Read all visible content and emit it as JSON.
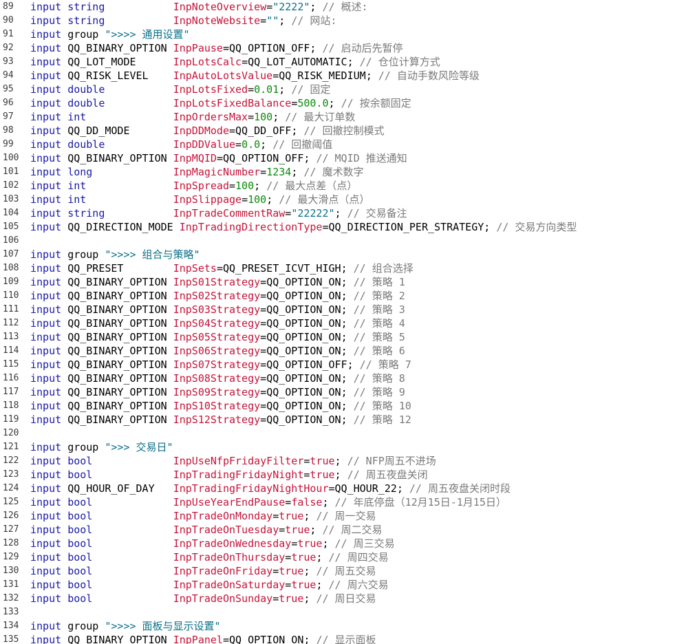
{
  "editor": {
    "lines": [
      {
        "no": "89",
        "kind": "decl",
        "kw": "input",
        "type": "string",
        "name": "InpNoteOverview",
        "value": "\"2222\"",
        "vtype": "str",
        "comment": "// 概述:"
      },
      {
        "no": "90",
        "kind": "decl",
        "kw": "input",
        "type": "string",
        "name": "InpNoteWebsite",
        "value": "\"\"",
        "vtype": "str",
        "comment": "// 网站:"
      },
      {
        "no": "91",
        "kind": "group",
        "kw": "input",
        "type": "group",
        "text": "\">>>> 通用设置\""
      },
      {
        "no": "92",
        "kind": "decl",
        "kw": "input",
        "type": "QQ_BINARY_OPTION",
        "name": "InpPause",
        "value": "QQ_OPTION_OFF",
        "vtype": "enum",
        "comment": "// 启动后先暂停"
      },
      {
        "no": "93",
        "kind": "decl",
        "kw": "input",
        "type": "QQ_LOT_MODE",
        "name": "InpLotsCalc",
        "value": "QQ_LOT_AUTOMATIC",
        "vtype": "enum",
        "comment": "// 仓位计算方式"
      },
      {
        "no": "94",
        "kind": "decl",
        "kw": "input",
        "type": "QQ_RISK_LEVEL",
        "name": "InpAutoLotsValue",
        "value": "QQ_RISK_MEDIUM",
        "vtype": "enum",
        "comment": "// 自动手数风险等级"
      },
      {
        "no": "95",
        "kind": "decl",
        "kw": "input",
        "type": "double",
        "name": "InpLotsFixed",
        "value": "0.01",
        "vtype": "num",
        "comment": "// 固定"
      },
      {
        "no": "96",
        "kind": "decl",
        "kw": "input",
        "type": "double",
        "name": "InpLotsFixedBalance",
        "value": "500.0",
        "vtype": "num",
        "comment": "// 按余额固定"
      },
      {
        "no": "97",
        "kind": "decl",
        "kw": "input",
        "type": "int",
        "name": "InpOrdersMax",
        "value": "100",
        "vtype": "num",
        "comment": "// 最大订单数"
      },
      {
        "no": "98",
        "kind": "decl",
        "kw": "input",
        "type": "QQ_DD_MODE",
        "name": "InpDDMode",
        "value": "QQ_DD_OFF",
        "vtype": "enum",
        "comment": "// 回撤控制模式"
      },
      {
        "no": "99",
        "kind": "decl",
        "kw": "input",
        "type": "double",
        "name": "InpDDValue",
        "value": "0.0",
        "vtype": "num",
        "comment": "// 回撤阈值"
      },
      {
        "no": "100",
        "kind": "decl",
        "kw": "input",
        "type": "QQ_BINARY_OPTION",
        "name": "InpMQID",
        "value": "QQ_OPTION_OFF",
        "vtype": "enum",
        "comment": "// MQID 推送通知"
      },
      {
        "no": "101",
        "kind": "decl",
        "kw": "input",
        "type": "long",
        "name": "InpMagicNumber",
        "value": "1234",
        "vtype": "num",
        "comment": "// 魔术数字"
      },
      {
        "no": "102",
        "kind": "decl",
        "kw": "input",
        "type": "int",
        "name": "InpSpread",
        "value": "100",
        "vtype": "num",
        "comment": "// 最大点差（点）"
      },
      {
        "no": "103",
        "kind": "decl",
        "kw": "input",
        "type": "int",
        "name": "InpSlippage",
        "value": "100",
        "vtype": "num",
        "comment": "// 最大滑点（点）"
      },
      {
        "no": "104",
        "kind": "decl",
        "kw": "input",
        "type": "string",
        "name": "InpTradeCommentRaw",
        "value": "\"22222\"",
        "vtype": "str",
        "comment": "// 交易备注"
      },
      {
        "no": "105",
        "kind": "decl",
        "kw": "input",
        "type": "QQ_DIRECTION_MODE",
        "name": "InpTradingDirectionType",
        "value": "QQ_DIRECTION_PER_STRATEGY",
        "vtype": "enum",
        "comment": "// 交易方向类型"
      },
      {
        "no": "106",
        "kind": "blank"
      },
      {
        "no": "107",
        "kind": "group",
        "kw": "input",
        "type": "group",
        "text": "\">>>> 组合与策略\""
      },
      {
        "no": "108",
        "kind": "decl",
        "kw": "input",
        "type": "QQ_PRESET",
        "name": "InpSets",
        "value": "QQ_PRESET_ICVT_HIGH",
        "vtype": "enum",
        "comment": "// 组合选择"
      },
      {
        "no": "109",
        "kind": "decl",
        "kw": "input",
        "type": "QQ_BINARY_OPTION",
        "name": "InpS01Strategy",
        "value": "QQ_OPTION_ON",
        "vtype": "enum",
        "comment": "// 策略 1"
      },
      {
        "no": "110",
        "kind": "decl",
        "kw": "input",
        "type": "QQ_BINARY_OPTION",
        "name": "InpS02Strategy",
        "value": "QQ_OPTION_ON",
        "vtype": "enum",
        "comment": "// 策略 2"
      },
      {
        "no": "111",
        "kind": "decl",
        "kw": "input",
        "type": "QQ_BINARY_OPTION",
        "name": "InpS03Strategy",
        "value": "QQ_OPTION_ON",
        "vtype": "enum",
        "comment": "// 策略 3"
      },
      {
        "no": "112",
        "kind": "decl",
        "kw": "input",
        "type": "QQ_BINARY_OPTION",
        "name": "InpS04Strategy",
        "value": "QQ_OPTION_ON",
        "vtype": "enum",
        "comment": "// 策略 4"
      },
      {
        "no": "113",
        "kind": "decl",
        "kw": "input",
        "type": "QQ_BINARY_OPTION",
        "name": "InpS05Strategy",
        "value": "QQ_OPTION_ON",
        "vtype": "enum",
        "comment": "// 策略 5"
      },
      {
        "no": "114",
        "kind": "decl",
        "kw": "input",
        "type": "QQ_BINARY_OPTION",
        "name": "InpS06Strategy",
        "value": "QQ_OPTION_ON",
        "vtype": "enum",
        "comment": "// 策略 6"
      },
      {
        "no": "115",
        "kind": "decl",
        "kw": "input",
        "type": "QQ_BINARY_OPTION",
        "name": "InpS07Strategy",
        "value": "QQ_OPTION_OFF",
        "vtype": "enum",
        "comment": "// 策略 7"
      },
      {
        "no": "116",
        "kind": "decl",
        "kw": "input",
        "type": "QQ_BINARY_OPTION",
        "name": "InpS08Strategy",
        "value": "QQ_OPTION_ON",
        "vtype": "enum",
        "comment": "// 策略 8"
      },
      {
        "no": "117",
        "kind": "decl",
        "kw": "input",
        "type": "QQ_BINARY_OPTION",
        "name": "InpS09Strategy",
        "value": "QQ_OPTION_ON",
        "vtype": "enum",
        "comment": "// 策略 9"
      },
      {
        "no": "118",
        "kind": "decl",
        "kw": "input",
        "type": "QQ_BINARY_OPTION",
        "name": "InpS10Strategy",
        "value": "QQ_OPTION_ON",
        "vtype": "enum",
        "comment": "// 策略 10"
      },
      {
        "no": "119",
        "kind": "decl",
        "kw": "input",
        "type": "QQ_BINARY_OPTION",
        "name": "InpS12Strategy",
        "value": "QQ_OPTION_ON",
        "vtype": "enum",
        "comment": "// 策略 12"
      },
      {
        "no": "120",
        "kind": "blank"
      },
      {
        "no": "121",
        "kind": "group",
        "kw": "input",
        "type": "group",
        "text": "\">>> 交易日\""
      },
      {
        "no": "122",
        "kind": "decl",
        "kw": "input",
        "type": "bool",
        "name": "InpUseNfpFridayFilter",
        "value": "true",
        "vtype": "kwv",
        "comment": "// NFP周五不进场"
      },
      {
        "no": "123",
        "kind": "decl",
        "kw": "input",
        "type": "bool",
        "name": "InpTradingFridayNight",
        "value": "true",
        "vtype": "kwv",
        "comment": "// 周五夜盘关闭"
      },
      {
        "no": "124",
        "kind": "decl",
        "kw": "input",
        "type": "QQ_HOUR_OF_DAY",
        "name": "InpTradingFridayNightHour",
        "value": "QQ_HOUR_22",
        "vtype": "enum",
        "comment": "// 周五夜盘关闭时段"
      },
      {
        "no": "125",
        "kind": "decl",
        "kw": "input",
        "type": "bool",
        "name": "InpUseYearEndPause",
        "value": "false",
        "vtype": "kwv",
        "comment": "// 年底停盘（12月15日-1月15日）"
      },
      {
        "no": "126",
        "kind": "decl",
        "kw": "input",
        "type": "bool",
        "name": "InpTradeOnMonday",
        "value": "true",
        "vtype": "kwv",
        "comment": "// 周一交易"
      },
      {
        "no": "127",
        "kind": "decl",
        "kw": "input",
        "type": "bool",
        "name": "InpTradeOnTuesday",
        "value": "true",
        "vtype": "kwv",
        "comment": "// 周二交易"
      },
      {
        "no": "128",
        "kind": "decl",
        "kw": "input",
        "type": "bool",
        "name": "InpTradeOnWednesday",
        "value": "true",
        "vtype": "kwv",
        "comment": "// 周三交易"
      },
      {
        "no": "129",
        "kind": "decl",
        "kw": "input",
        "type": "bool",
        "name": "InpTradeOnThursday",
        "value": "true",
        "vtype": "kwv",
        "comment": "// 周四交易"
      },
      {
        "no": "130",
        "kind": "decl",
        "kw": "input",
        "type": "bool",
        "name": "InpTradeOnFriday",
        "value": "true",
        "vtype": "kwv",
        "comment": "// 周五交易"
      },
      {
        "no": "131",
        "kind": "decl",
        "kw": "input",
        "type": "bool",
        "name": "InpTradeOnSaturday",
        "value": "true",
        "vtype": "kwv",
        "comment": "// 周六交易"
      },
      {
        "no": "132",
        "kind": "decl",
        "kw": "input",
        "type": "bool",
        "name": "InpTradeOnSunday",
        "value": "true",
        "vtype": "kwv",
        "comment": "// 周日交易"
      },
      {
        "no": "133",
        "kind": "blank"
      },
      {
        "no": "134",
        "kind": "group",
        "kw": "input",
        "type": "group",
        "text": "\">>>> 面板与显示设置\""
      },
      {
        "no": "135",
        "kind": "decl",
        "kw": "input",
        "type": "QQ_BINARY_OPTION",
        "name": "InpPanel",
        "value": "QQ_OPTION_ON",
        "vtype": "enum",
        "comment": "// 显示面板"
      }
    ]
  },
  "colors": {
    "keyword": "#1a1aa6",
    "identifier": "#c5143a",
    "string": "#0a6f8a",
    "number": "#0a8a0a",
    "comment": "#7a7a7a"
  }
}
